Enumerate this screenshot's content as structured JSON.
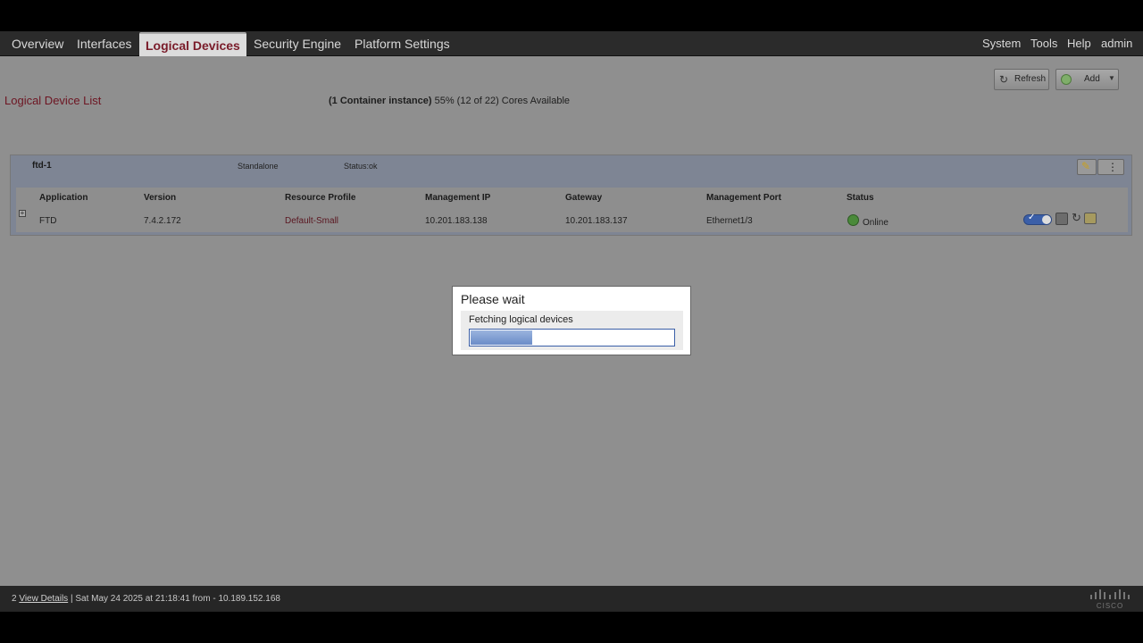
{
  "nav": {
    "tabs": [
      {
        "label": "Overview"
      },
      {
        "label": "Interfaces"
      },
      {
        "label": "Logical Devices"
      },
      {
        "label": "Security Engine"
      },
      {
        "label": "Platform Settings"
      }
    ],
    "active_tab": "Logical Devices",
    "right_menu": [
      {
        "label": "System"
      },
      {
        "label": "Tools"
      },
      {
        "label": "Help"
      },
      {
        "label": "admin"
      }
    ]
  },
  "page": {
    "title": "Logical Device List",
    "cores_bold": "(1 Container instance)",
    "cores_text": "55% (12 of 22) Cores Available"
  },
  "toolbar": {
    "refresh_label": "Refresh",
    "add_label": "Add"
  },
  "device": {
    "name": "ftd-1",
    "mode": "Standalone",
    "status": "Status:ok",
    "columns": [
      "Application",
      "Version",
      "Resource Profile",
      "Management IP",
      "Gateway",
      "Management Port",
      "Status"
    ],
    "row": {
      "application": "FTD",
      "version": "7.4.2.172",
      "resource_profile": "Default-Small",
      "management_ip": "10.201.183.138",
      "gateway": "10.201.183.137",
      "management_port": "Ethernet1/3",
      "status": "Online"
    }
  },
  "dialog": {
    "title": "Please wait",
    "message": "Fetching logical devices",
    "progress": 0.3
  },
  "footer": {
    "count": "2",
    "link": "View Details",
    "text": "| Sat May 24 2025 at 21:18:41 from - 10.189.152.168"
  },
  "colors": {
    "accent": "#7a1c2a",
    "online": "#4a8a3a",
    "progress": "#6b8cc8"
  }
}
